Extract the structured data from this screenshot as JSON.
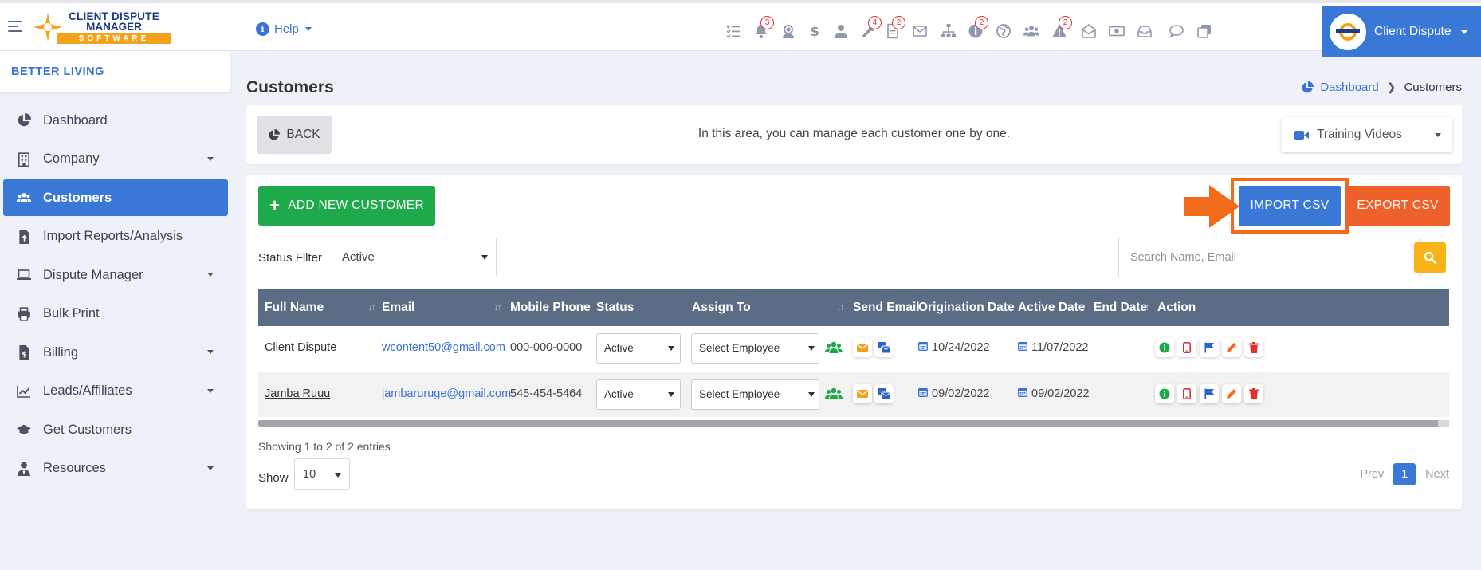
{
  "logo": {
    "line1": "CLIENT DISPUTE",
    "line2": "MANAGER",
    "line3": "SOFTWARE"
  },
  "header": {
    "help_label": "Help",
    "profile_name": "Client Dispute",
    "toolbar_icons": [
      {
        "name": "tasks-icon",
        "badge": ""
      },
      {
        "name": "bell-icon",
        "badge": "3"
      },
      {
        "name": "support-agent-icon",
        "badge": ""
      },
      {
        "name": "dollar-icon",
        "badge": ""
      },
      {
        "name": "user-tie-icon",
        "badge": ""
      },
      {
        "name": "wrench-icon",
        "badge": "4"
      },
      {
        "name": "document-icon",
        "badge": "2"
      },
      {
        "name": "envelope-icon",
        "badge": ""
      },
      {
        "name": "sitemap-icon",
        "badge": ""
      },
      {
        "name": "info-icon",
        "badge": "2"
      },
      {
        "name": "globe-icon",
        "badge": ""
      },
      {
        "name": "users-icon",
        "badge": ""
      },
      {
        "name": "warning-icon",
        "badge": "2"
      },
      {
        "name": "mail-open-icon",
        "badge": ""
      },
      {
        "name": "money-icon",
        "badge": ""
      },
      {
        "name": "inbox-icon",
        "badge": ""
      },
      {
        "name": "chat-icon",
        "badge": ""
      },
      {
        "name": "copy-icon",
        "badge": ""
      }
    ]
  },
  "sidebar": {
    "org_name": "BETTER LIVING",
    "items": [
      {
        "label": "Dashboard",
        "icon": "chart-pie-icon",
        "has_caret": false,
        "active": false
      },
      {
        "label": "Company",
        "icon": "building-icon",
        "has_caret": true,
        "active": false
      },
      {
        "label": "Customers",
        "icon": "users-icon",
        "has_caret": false,
        "active": true
      },
      {
        "label": "Import Reports/Analysis",
        "icon": "file-import-icon",
        "has_caret": false,
        "active": false
      },
      {
        "label": "Dispute Manager",
        "icon": "laptop-icon",
        "has_caret": true,
        "active": false
      },
      {
        "label": "Bulk Print",
        "icon": "printer-icon",
        "has_caret": false,
        "active": false
      },
      {
        "label": "Billing",
        "icon": "invoice-icon",
        "has_caret": true,
        "active": false
      },
      {
        "label": "Leads/Affiliates",
        "icon": "line-chart-icon",
        "has_caret": true,
        "active": false
      },
      {
        "label": "Get Customers",
        "icon": "graduation-cap-icon",
        "has_caret": false,
        "active": false
      },
      {
        "label": "Resources",
        "icon": "user-tie-icon",
        "has_caret": true,
        "active": false
      }
    ]
  },
  "page": {
    "title": "Customers",
    "breadcrumb": {
      "home": "Dashboard",
      "current": "Customers"
    }
  },
  "info_bar": {
    "back_label": "BACK",
    "message": "In this area, you can manage each customer one by one.",
    "training_label": "Training Videos"
  },
  "actions": {
    "add_label": "ADD NEW CUSTOMER",
    "import_label": "IMPORT CSV",
    "export_label": "EXPORT CSV"
  },
  "filters": {
    "status_label": "Status Filter",
    "status_value": "Active",
    "search_placeholder": "Search Name, Email"
  },
  "table": {
    "columns": [
      "Full Name",
      "Email",
      "Mobile Phone",
      "Status",
      "Assign To",
      "Send Email",
      "Origination Date",
      "Active Date",
      "End Date",
      "Action"
    ],
    "rows": [
      {
        "name": "Client Dispute",
        "email": "wcontent50@gmail.com",
        "phone": "000-000-0000",
        "status": "Active",
        "assign": "Select Employee",
        "origination": "10/24/2022",
        "active_date": "11/07/2022",
        "end_date": ""
      },
      {
        "name": "Jamba Ruuu",
        "email": "jambaruruge@gmail.com",
        "phone": "545-454-5464",
        "status": "Active",
        "assign": "Select Employee",
        "origination": "09/02/2022",
        "active_date": "09/02/2022",
        "end_date": ""
      }
    ],
    "showing_text": "Showing 1 to 2 of 2 entries",
    "show_label": "Show",
    "page_size": "10",
    "pager": {
      "prev": "Prev",
      "current": "1",
      "next": "Next"
    }
  },
  "colors": {
    "primary": "#3a78d8",
    "success": "#1ea94a",
    "export": "#f0602a",
    "highlight": "#f26a1b",
    "search_button": "#f9b218",
    "table_header": "#5b6d85"
  }
}
